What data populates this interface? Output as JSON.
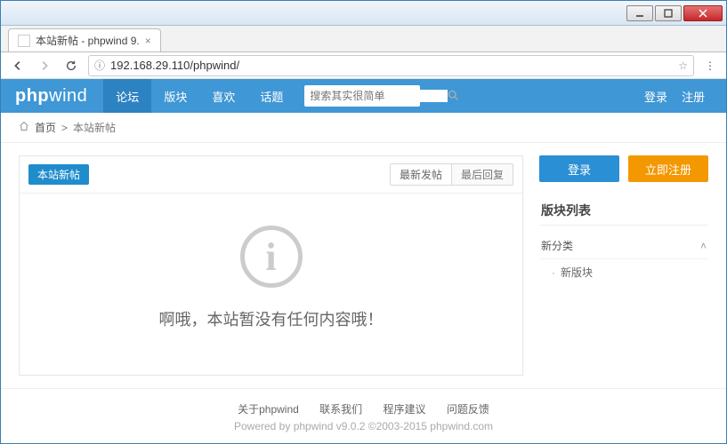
{
  "window": {
    "tab_title": "本站新帖 - phpwind 9.",
    "url": "192.168.29.110/phpwind/"
  },
  "header": {
    "brand_prefix": "php",
    "brand_suffix": "wind",
    "nav": [
      "论坛",
      "版块",
      "喜欢",
      "话题"
    ],
    "search_placeholder": "搜索其实很简单",
    "login": "登录",
    "register": "注册"
  },
  "breadcrumb": {
    "home": "首页",
    "current": "本站新帖"
  },
  "main": {
    "active_tab": "本站新帖",
    "sort": [
      "最新发帖",
      "最后回复"
    ],
    "empty_glyph": "i",
    "empty_text": "啊哦，本站暂没有任何内容哦！"
  },
  "sidebar": {
    "login_btn": "登录",
    "register_btn": "立即注册",
    "block_list_title": "版块列表",
    "category": "新分类",
    "category_child": "新版块"
  },
  "footer": {
    "links": [
      "关于phpwind",
      "联系我们",
      "程序建议",
      "问题反馈"
    ],
    "powered": "Powered by phpwind v9.0.2 ©2003-2015 phpwind.com"
  }
}
